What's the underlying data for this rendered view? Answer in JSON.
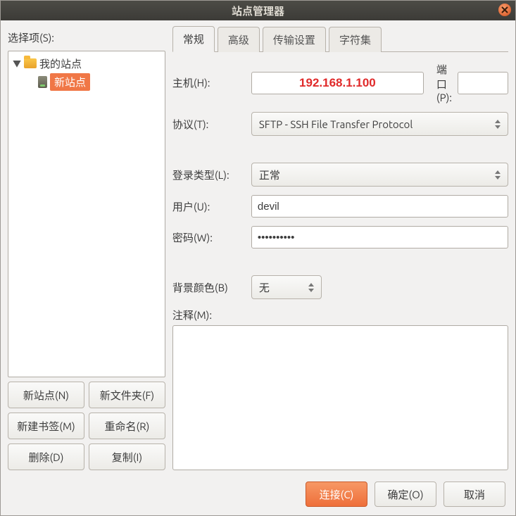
{
  "window": {
    "title": "站点管理器"
  },
  "left": {
    "select_label": "选择项(S):",
    "tree": {
      "root_label": "我的站点",
      "site_label": "新站点"
    },
    "buttons": {
      "new_site": "新站点(N)",
      "new_folder": "新文件夹(F)",
      "new_bookmark": "新建书签(M)",
      "rename": "重命名(R)",
      "delete": "删除(D)",
      "copy": "复制(I)"
    }
  },
  "tabs": {
    "general": "常规",
    "advanced": "高级",
    "transfer": "传输设置",
    "charset": "字符集"
  },
  "form": {
    "host_label": "主机(H):",
    "host_value": "192.168.1.100",
    "port_label": "端口(P):",
    "port_value": "",
    "protocol_label": "协议(T):",
    "protocol_value": "SFTP - SSH File Transfer Protocol",
    "logon_type_label": "登录类型(L):",
    "logon_type_value": "正常",
    "user_label": "用户(U):",
    "user_value": "devil",
    "password_label": "密码(W):",
    "password_value": "••••••••••",
    "bgcolor_label": "背景颜色(B)",
    "bgcolor_value": "无",
    "comments_label": "注释(M):",
    "comments_value": ""
  },
  "footer": {
    "connect": "连接(C)",
    "ok": "确定(O)",
    "cancel": "取消"
  }
}
